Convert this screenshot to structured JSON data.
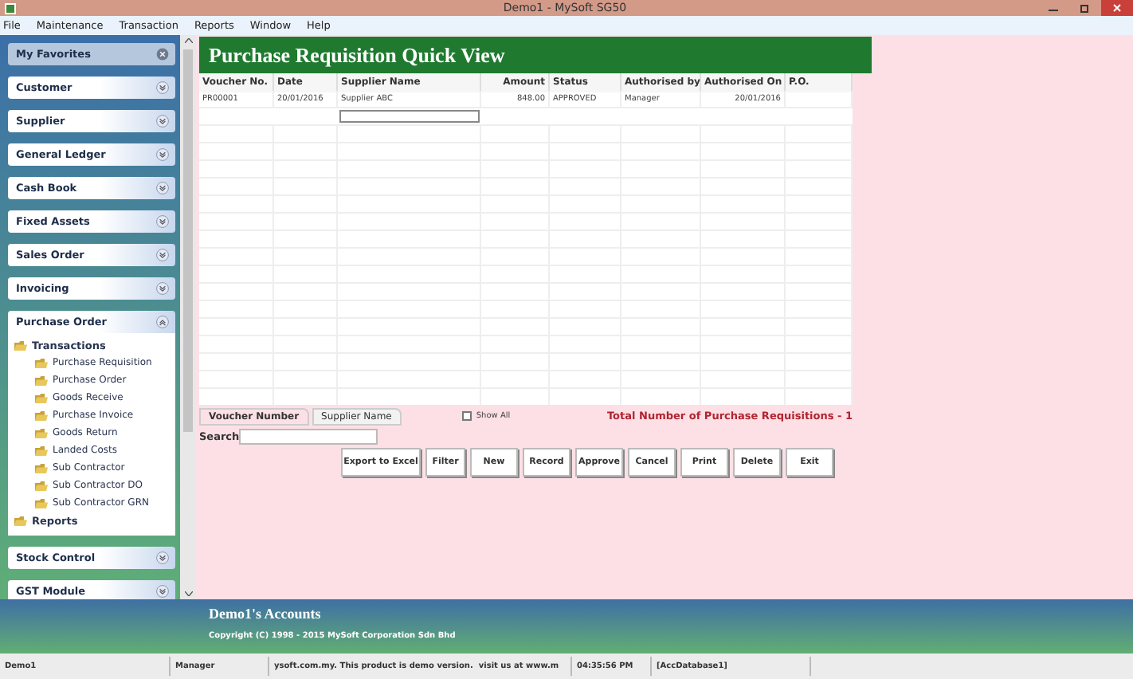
{
  "window": {
    "title": "Demo1 - MySoft SG50"
  },
  "menu": [
    "File",
    "Maintenance",
    "Transaction",
    "Reports",
    "Window",
    "Help"
  ],
  "sidebar": {
    "favorites": "My Favorites",
    "sections": [
      {
        "label": "Customer",
        "expanded": false
      },
      {
        "label": "Supplier",
        "expanded": false
      },
      {
        "label": "General Ledger",
        "expanded": false
      },
      {
        "label": "Cash Book",
        "expanded": false
      },
      {
        "label": "Fixed Assets",
        "expanded": false
      },
      {
        "label": "Sales Order",
        "expanded": false
      },
      {
        "label": "Invoicing",
        "expanded": false
      },
      {
        "label": "Purchase Order",
        "expanded": true,
        "children": [
          {
            "label": "Transactions",
            "children": [
              {
                "label": "Purchase Requisition"
              },
              {
                "label": "Purchase Order"
              },
              {
                "label": "Goods Receive"
              },
              {
                "label": "Purchase Invoice"
              },
              {
                "label": "Goods Return"
              },
              {
                "label": "Landed Costs"
              },
              {
                "label": "Sub Contractor"
              },
              {
                "label": "Sub Contractor DO"
              },
              {
                "label": "Sub Contractor GRN"
              }
            ]
          },
          {
            "label": "Reports"
          }
        ]
      },
      {
        "label": "Stock Control",
        "expanded": false
      },
      {
        "label": "GST Module",
        "expanded": false
      }
    ]
  },
  "content": {
    "title": "Purchase Requisition Quick View",
    "table": {
      "columns": [
        "Voucher No.",
        "Date",
        "Supplier Name",
        "Amount",
        "Status",
        "Authorised by",
        "Authorised On",
        "P.O."
      ],
      "rows": [
        [
          "PR00001",
          "20/01/2016",
          "Supplier ABC",
          "848.00",
          "APPROVED",
          "Manager",
          "20/01/2016",
          ""
        ]
      ]
    },
    "sort_tabs": [
      {
        "label": "Voucher Number",
        "selected": true
      },
      {
        "label": "Supplier Name",
        "selected": false
      }
    ],
    "show_all": {
      "label": "Show All",
      "checked": false
    },
    "total": "Total Number of Purchase Requisitions - 1",
    "search": {
      "label": "Search"
    },
    "buttons": [
      "Export to Excel",
      "Filter",
      "New",
      "Record",
      "Approve",
      "Cancel",
      "Print",
      "Delete",
      "Exit"
    ]
  },
  "footer": {
    "title": "Demo1's Accounts",
    "copyright": "Copyright (C) 1998 - 2015 MySoft Corporation Sdn Bhd"
  },
  "status_bar": [
    "Demo1",
    "Manager",
    "ysoft.com.my. This product is demo version.  visit us at www.m",
    "04:35:56 PM",
    "[AccDatabase1]"
  ]
}
